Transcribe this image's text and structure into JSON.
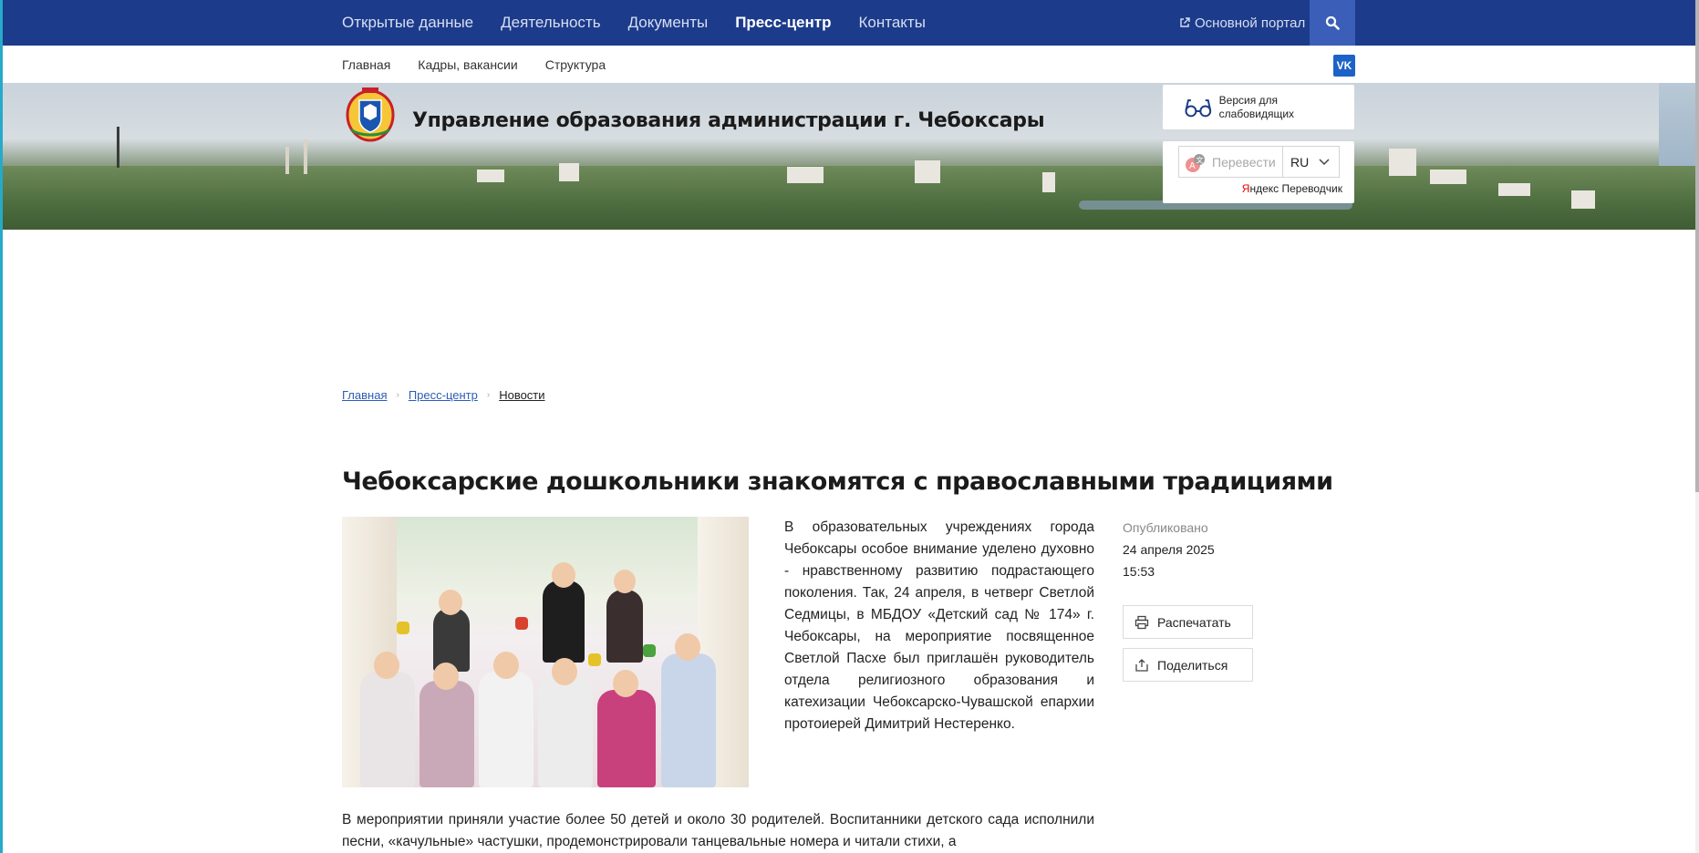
{
  "topnav": {
    "items": [
      "Открытые данные",
      "Деятельность",
      "Документы",
      "Пресс-центр",
      "Контакты"
    ],
    "active": "Пресс-центр",
    "portal_link": "Основной портал"
  },
  "subnav": {
    "items": [
      "Главная",
      "Кадры, вакансии",
      "Структура"
    ],
    "vk_label": "VK"
  },
  "header": {
    "org_title": "Управление образования администрации г. Чебоксары",
    "vision_label": "Версия для слабовидящих",
    "translate_placeholder": "Перевести",
    "translate_lang": "RU",
    "translator_credit_prefix": "Я",
    "translator_credit_rest": "ндекс Переводчик"
  },
  "breadcrumb": {
    "items": [
      "Главная",
      "Пресс-центр",
      "Новости"
    ]
  },
  "article": {
    "title": "Чебоксарские дошкольники знакомятся с православными традициями",
    "lead": "В образовательных учреждениях города Чебоксары особое внимание уделено духовно - нравственному развитию подрастающего поколения. Так, 24 апреля, в четверг Светлой Седмицы, в МБДОУ «Детский сад № 174» г. Чебоксары, на мероприятие посвященное Светлой Пасхе был приглашён руководитель отдела религиозного образования и катехизации Чебоксарско-Чувашской епархии протоиерей Димитрий Нестеренко.",
    "body": "В мероприятии приняли участие более 50 детей и около 30 родителей. Воспитанники детского сада исполнили песни, «качульные» частушки, продемонстрировали танцевальные номера и читали стихи, а"
  },
  "meta": {
    "published_label": "Опубликовано",
    "published_date": "24 апреля 2025",
    "published_time": "15:53",
    "print_label": "Распечатать",
    "share_label": "Поделиться"
  },
  "colors": {
    "topnav_bg": "#1c3b8a",
    "search_bg": "#3b5eb8",
    "link": "#2c5db5",
    "vk": "#1d63c7"
  }
}
